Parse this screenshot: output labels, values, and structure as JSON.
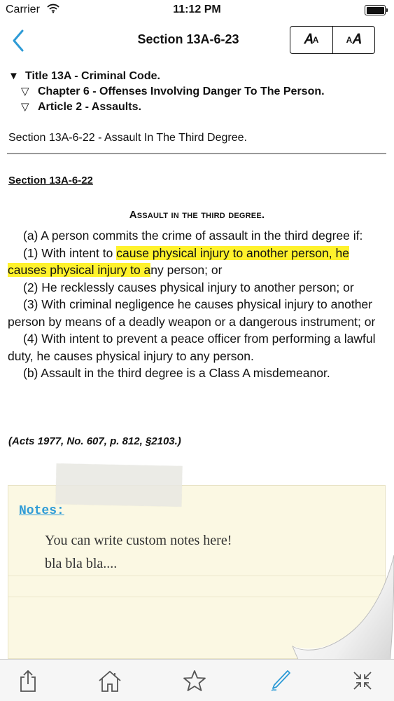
{
  "status_bar": {
    "carrier": "Carrier",
    "time": "11:12 PM",
    "wifi_icon": "wifi-icon",
    "battery_icon": "battery-icon"
  },
  "nav": {
    "title": "Section 13A-6-23",
    "back_icon": "chevron-left-icon",
    "font_decrease_label": "A",
    "font_increase_label": "A",
    "accent_color": "#2e9bd6"
  },
  "breadcrumb": {
    "items": [
      {
        "marker": "▼",
        "label": "Title 13A - Criminal Code."
      },
      {
        "marker": "▽",
        "label": "Chapter 6 - Offenses Involving Danger To The Person."
      },
      {
        "marker": "▽",
        "label": "Article 2 - Assaults."
      }
    ]
  },
  "current_section": "Section 13A-6-22 - Assault In The Third Degree.",
  "content": {
    "section_label": "Section 13A-6-22",
    "heading": "Assault in the third degree.",
    "paragraphs": {
      "p0": "(a) A person commits the crime of assault in the third degree if:",
      "p1_before": "(1) With intent to ",
      "p1_highlight": "cause physical injury to another person, he causes physical injury to a",
      "p1_after": "ny person; or",
      "p2": "(2) He recklessly causes physical injury to another person; or",
      "p3": "(3) With criminal negligence he causes physical injury to another person by means of a deadly weapon or a dangerous instrument; or",
      "p4": "(4) With intent to prevent a peace officer from performing a lawful duty, he causes physical injury to any person.",
      "p5": "(b) Assault in the third degree is a Class A misdemeanor."
    },
    "highlight_color": "#fff22c",
    "citation": "(Acts 1977, No. 607, p. 812, §2103.)"
  },
  "notes": {
    "label": "Notes:",
    "line1": "You can write custom notes here!",
    "line2": "bla bla bla....",
    "background_color": "#fbf8e3"
  },
  "toolbar": {
    "share_icon": "share-icon",
    "home_icon": "home-icon",
    "bookmark_icon": "star-icon",
    "annotate_icon": "pen-icon",
    "collapse_icon": "collapse-icon"
  }
}
